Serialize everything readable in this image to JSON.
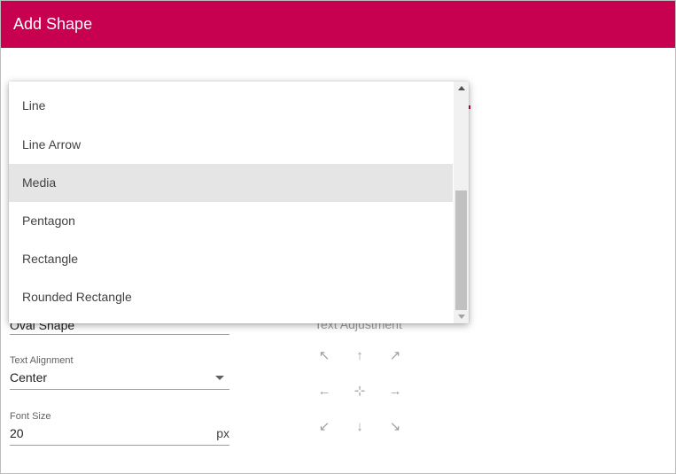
{
  "header": {
    "title": "Add Shape"
  },
  "form": {
    "hidden_value": "Oval Shape",
    "text_alignment": {
      "label": "Text Alignment",
      "value": "Center"
    },
    "font_size": {
      "label": "Font Size",
      "value": "20",
      "unit": "px"
    },
    "text_adjustment": {
      "label": "Text Adjustment"
    }
  },
  "dropdown": {
    "options": [
      "Line",
      "Line Arrow",
      "Media",
      "Pentagon",
      "Rectangle",
      "Rounded Rectangle"
    ],
    "selected": "Media"
  },
  "icons": {
    "up_left": "↖",
    "up": "↑",
    "up_right": "↗",
    "left": "←",
    "center": "⊹",
    "right": "→",
    "down_left": "↙",
    "down": "↓",
    "down_right": "↘"
  },
  "colors": {
    "header": "#c70050",
    "selected_option_bg": "#e5e5e5"
  }
}
